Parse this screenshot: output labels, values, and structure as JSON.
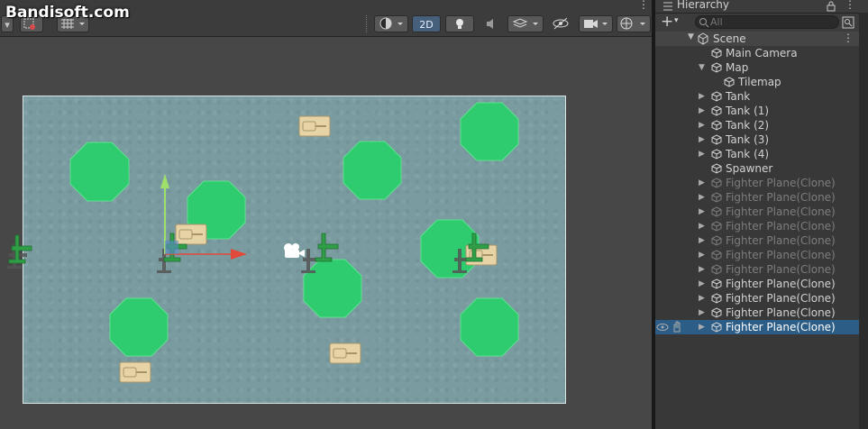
{
  "watermark": "Bandisoft.com",
  "toolbar": {
    "mode_2d_label": "2D"
  },
  "hierarchy": {
    "tab_title": "Hierarchy",
    "add_label": "+",
    "search_placeholder": "All",
    "scene_name": "Scene",
    "items": [
      {
        "label": "Main Camera",
        "depth": 1,
        "expandable": false,
        "dim": false
      },
      {
        "label": "Map",
        "depth": 1,
        "expandable": true,
        "expanded": true,
        "dim": false
      },
      {
        "label": "Tilemap",
        "depth": 2,
        "expandable": false,
        "dim": false
      },
      {
        "label": "Tank",
        "depth": 1,
        "expandable": true,
        "dim": false
      },
      {
        "label": "Tank (1)",
        "depth": 1,
        "expandable": true,
        "dim": false
      },
      {
        "label": "Tank (2)",
        "depth": 1,
        "expandable": true,
        "dim": false
      },
      {
        "label": "Tank (3)",
        "depth": 1,
        "expandable": true,
        "dim": false
      },
      {
        "label": "Tank (4)",
        "depth": 1,
        "expandable": true,
        "dim": false
      },
      {
        "label": "Spawner",
        "depth": 1,
        "expandable": false,
        "dim": false
      },
      {
        "label": "Fighter Plane(Clone)",
        "depth": 1,
        "expandable": true,
        "dim": true
      },
      {
        "label": "Fighter Plane(Clone)",
        "depth": 1,
        "expandable": true,
        "dim": true
      },
      {
        "label": "Fighter Plane(Clone)",
        "depth": 1,
        "expandable": true,
        "dim": true
      },
      {
        "label": "Fighter Plane(Clone)",
        "depth": 1,
        "expandable": true,
        "dim": true
      },
      {
        "label": "Fighter Plane(Clone)",
        "depth": 1,
        "expandable": true,
        "dim": true
      },
      {
        "label": "Fighter Plane(Clone)",
        "depth": 1,
        "expandable": true,
        "dim": true
      },
      {
        "label": "Fighter Plane(Clone)",
        "depth": 1,
        "expandable": true,
        "dim": true
      },
      {
        "label": "Fighter Plane(Clone)",
        "depth": 1,
        "expandable": true,
        "dim": false
      },
      {
        "label": "Fighter Plane(Clone)",
        "depth": 1,
        "expandable": true,
        "dim": false
      },
      {
        "label": "Fighter Plane(Clone)",
        "depth": 1,
        "expandable": true,
        "dim": false
      },
      {
        "label": "Fighter Plane(Clone)",
        "depth": 1,
        "expandable": true,
        "dim": false,
        "selected": true
      }
    ]
  },
  "colors": {
    "map_bg": "#7a9ca1",
    "octagon": "#2ecc6f",
    "plane": "#2f9e47",
    "tank": "#e6d3a6",
    "gizmo_y": "#9fe06a",
    "gizmo_x": "#e04a3a",
    "selection": "#2c5d87"
  },
  "icons": [
    "cube-icon",
    "eye-icon",
    "hand-icon",
    "lock-icon",
    "search-icon",
    "light-icon",
    "audio-icon",
    "camera-icon",
    "gizmo-icon"
  ]
}
